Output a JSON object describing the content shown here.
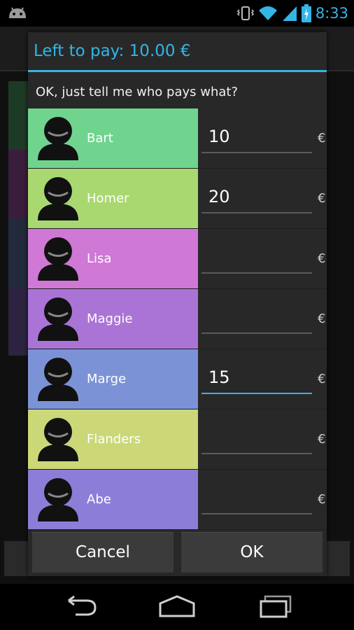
{
  "status_bar": {
    "time": "8:33",
    "icons": [
      "android-notification-icon",
      "vibrate-icon",
      "wifi-icon",
      "signal-icon",
      "battery-icon"
    ],
    "accent_color": "#33b5e5"
  },
  "dialog": {
    "title": "Left to pay: 10.00 €",
    "message": "OK, just tell me who pays what?",
    "currency": "€",
    "rows": [
      {
        "name": "Bart",
        "amount": "10",
        "color": "#70d48f"
      },
      {
        "name": "Homer",
        "amount": "20",
        "color": "#a9d870"
      },
      {
        "name": "Lisa",
        "amount": "",
        "color": "#cf78d6"
      },
      {
        "name": "Maggie",
        "amount": "",
        "color": "#aa74d6"
      },
      {
        "name": "Marge",
        "amount": "15",
        "color": "#7b93d6",
        "focused": true
      },
      {
        "name": "Flanders",
        "amount": "",
        "color": "#ccd878"
      },
      {
        "name": "Abe",
        "amount": "",
        "color": "#8c7ed8"
      }
    ],
    "cancel_label": "Cancel",
    "ok_label": "OK"
  },
  "nav_bar": {
    "icons": [
      "back-icon",
      "home-icon",
      "recent-apps-icon"
    ]
  }
}
